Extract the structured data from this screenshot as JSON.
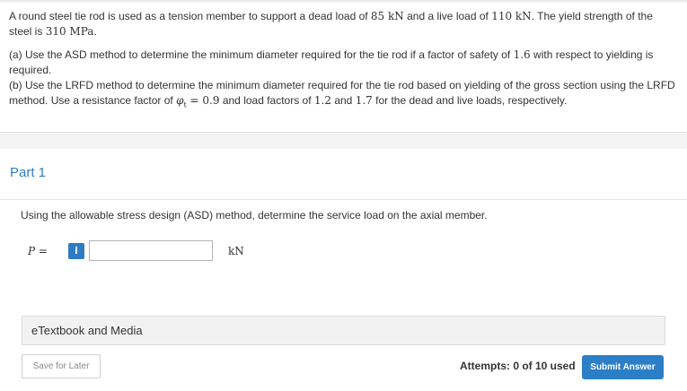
{
  "problem": {
    "intro_before_dead": "A round steel tie rod is used as a tension member to support a dead load of ",
    "dead_load": "85 kN",
    "intro_between_loads": " and a live load of ",
    "live_load": "110 kN",
    "intro_after_live": ". The yield strength of the steel is ",
    "yield_strength": "310 MPa",
    "intro_end": ".",
    "part_a_before": "(a) Use the ASD method to determine the minimum diameter required for the tie rod if a factor of safety of ",
    "part_a_fs": "1.6",
    "part_a_after": " with respect to yielding is required.",
    "part_b_before": "(b) Use the LRFD method to determine the minimum diameter required for the tie rod based on yielding of the gross section using the LRFD method. Use a resistance factor of ",
    "part_b_phi": "φ",
    "part_b_phi_sub": "t",
    "part_b_phi_value": " = 0.9",
    "part_b_mid": " and load factors of ",
    "part_b_factor1": "1.2",
    "part_b_and": " and ",
    "part_b_factor2": "1.7",
    "part_b_end": " for the dead and live loads, respectively."
  },
  "part": {
    "title": "Part 1",
    "question": "Using the allowable stress design (ASD) method, determine the service load on the axial member.",
    "variable": "P",
    "equals": " =",
    "info_icon": "i",
    "answer_value": "",
    "unit": "kN"
  },
  "resources": {
    "etextbook_label": "eTextbook and Media"
  },
  "footer": {
    "save_label": "Save for Later",
    "attempts_label": "Attempts: 0 of 10 used",
    "submit_label": "Submit Answer"
  },
  "colors": {
    "accent": "#2c7fc6",
    "part_title": "#2d7cc0"
  }
}
